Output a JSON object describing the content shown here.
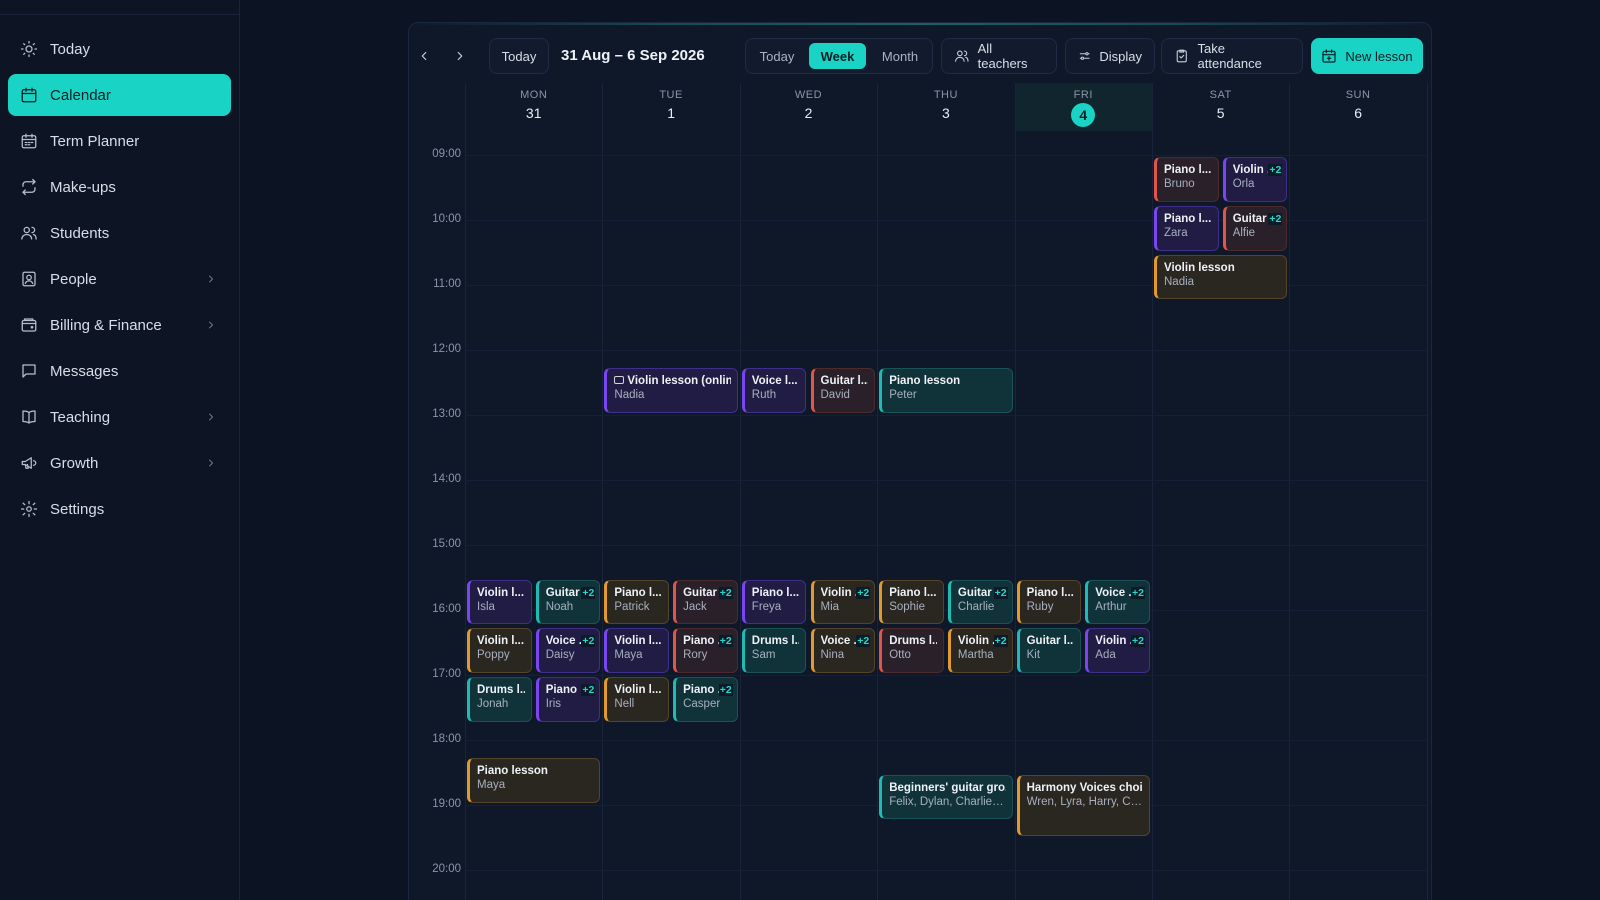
{
  "sidebar": {
    "items": [
      {
        "label": "Today",
        "icon": "sun-icon",
        "active": false
      },
      {
        "label": "Calendar",
        "icon": "calendar-icon",
        "active": true
      },
      {
        "label": "Term Planner",
        "icon": "calendar-grid-icon",
        "active": false
      },
      {
        "label": "Make-ups",
        "icon": "repeat-icon",
        "active": false
      },
      {
        "label": "Students",
        "icon": "users-icon",
        "active": false
      },
      {
        "label": "People",
        "icon": "contact-icon",
        "active": false
      },
      {
        "label": "Billing & Finance",
        "icon": "wallet-icon",
        "active": false
      },
      {
        "label": "Messages",
        "icon": "message-icon",
        "active": false
      },
      {
        "label": "Teaching",
        "icon": "book-icon",
        "active": false
      },
      {
        "label": "Growth",
        "icon": "megaphone-icon",
        "active": false
      },
      {
        "label": "Settings",
        "icon": "gear-icon",
        "active": false
      }
    ]
  },
  "toolbar": {
    "today_button": "Today",
    "range": "31 Aug – 6 Sep 2026",
    "views": [
      "Today",
      "Week",
      "Month"
    ],
    "active_view": "Week",
    "all_teachers": "All teachers",
    "display": "Display",
    "take_attendance": "Take attendance",
    "new_lesson": "New lesson"
  },
  "days": [
    {
      "name": "MON",
      "num": "31"
    },
    {
      "name": "TUE",
      "num": "1"
    },
    {
      "name": "WED",
      "num": "2"
    },
    {
      "name": "THU",
      "num": "3"
    },
    {
      "name": "FRI",
      "num": "4",
      "today": true
    },
    {
      "name": "SAT",
      "num": "5"
    },
    {
      "name": "SUN",
      "num": "6"
    }
  ],
  "times": [
    "09:00",
    "10:00",
    "11:00",
    "12:00",
    "13:00",
    "14:00",
    "15:00",
    "16:00",
    "17:00",
    "18:00",
    "19:00",
    "20:00"
  ],
  "events": [
    {
      "title": "Piano l...",
      "sub": "Bruno",
      "day": 5,
      "sub_col": 0,
      "cols": 2,
      "start": "09:00",
      "end": "09:45",
      "color": "pianored"
    },
    {
      "title": "Violin .",
      "sub": "Orla",
      "badge": "+2",
      "day": 5,
      "sub_col": 1,
      "cols": 2,
      "start": "09:00",
      "end": "09:45",
      "color": "violin"
    },
    {
      "title": "Piano l...",
      "sub": "Zara",
      "day": 5,
      "sub_col": 0,
      "cols": 2,
      "start": "09:45",
      "end": "10:30",
      "color": "purple"
    },
    {
      "title": "Guitar",
      "sub": "Alfie",
      "badge": "+2",
      "day": 5,
      "sub_col": 1,
      "cols": 2,
      "start": "09:45",
      "end": "10:30",
      "color": "red"
    },
    {
      "title": "Violin lesson",
      "sub": "Nadia",
      "day": 5,
      "sub_col": 0,
      "cols": 1,
      "start": "10:30",
      "end": "11:15",
      "color": "orange"
    },
    {
      "title": "Violin lesson (onlin...",
      "sub": "Nadia",
      "camera": true,
      "day": 1,
      "sub_col": 0,
      "cols": 1,
      "start": "12:15",
      "end": "13:00",
      "color": "purple"
    },
    {
      "title": "Voice l...",
      "sub": "Ruth",
      "day": 2,
      "sub_col": 0,
      "cols": 2,
      "start": "12:15",
      "end": "13:00",
      "color": "purple"
    },
    {
      "title": "Guitar l...",
      "sub": "David",
      "day": 2,
      "sub_col": 1,
      "cols": 2,
      "start": "12:15",
      "end": "13:00",
      "color": "red"
    },
    {
      "title": "Piano lesson",
      "sub": "Peter",
      "day": 3,
      "sub_col": 0,
      "cols": 1,
      "start": "12:15",
      "end": "13:00",
      "color": "teal"
    },
    {
      "title": "Violin l...",
      "sub": "Isla",
      "day": 0,
      "sub_col": 0,
      "cols": 2,
      "start": "15:30",
      "end": "16:15",
      "color": "purple"
    },
    {
      "title": "Guitar",
      "sub": "Noah",
      "badge": "+2",
      "day": 0,
      "sub_col": 1,
      "cols": 2,
      "start": "15:30",
      "end": "16:15",
      "color": "teal"
    },
    {
      "title": "Violin l...",
      "sub": "Poppy",
      "day": 0,
      "sub_col": 0,
      "cols": 2,
      "start": "16:15",
      "end": "17:00",
      "color": "orange"
    },
    {
      "title": "Voice .",
      "sub": "Daisy",
      "badge": "+2",
      "day": 0,
      "sub_col": 1,
      "cols": 2,
      "start": "16:15",
      "end": "17:00",
      "color": "purple"
    },
    {
      "title": "Drums l...",
      "sub": "Jonah",
      "day": 0,
      "sub_col": 0,
      "cols": 2,
      "start": "17:00",
      "end": "17:45",
      "color": "teal"
    },
    {
      "title": "Piano .",
      "sub": "Iris",
      "badge": "+2",
      "day": 0,
      "sub_col": 1,
      "cols": 2,
      "start": "17:00",
      "end": "17:45",
      "color": "purple"
    },
    {
      "title": "Piano l...",
      "sub": "Patrick",
      "day": 1,
      "sub_col": 0,
      "cols": 2,
      "start": "15:30",
      "end": "16:15",
      "color": "orange"
    },
    {
      "title": "Guitar",
      "sub": "Jack",
      "badge": "+2",
      "day": 1,
      "sub_col": 1,
      "cols": 2,
      "start": "15:30",
      "end": "16:15",
      "color": "red"
    },
    {
      "title": "Violin l...",
      "sub": "Maya",
      "day": 1,
      "sub_col": 0,
      "cols": 2,
      "start": "16:15",
      "end": "17:00",
      "color": "purple"
    },
    {
      "title": "Piano .",
      "sub": "Rory",
      "badge": "+2",
      "day": 1,
      "sub_col": 1,
      "cols": 2,
      "start": "16:15",
      "end": "17:00",
      "color": "red"
    },
    {
      "title": "Violin l...",
      "sub": "Nell",
      "day": 1,
      "sub_col": 0,
      "cols": 2,
      "start": "17:00",
      "end": "17:45",
      "color": "orange"
    },
    {
      "title": "Piano .",
      "sub": "Casper",
      "badge": "+2",
      "day": 1,
      "sub_col": 1,
      "cols": 2,
      "start": "17:00",
      "end": "17:45",
      "color": "teal"
    },
    {
      "title": "Piano l...",
      "sub": "Freya",
      "day": 2,
      "sub_col": 0,
      "cols": 2,
      "start": "15:30",
      "end": "16:15",
      "color": "purple"
    },
    {
      "title": "Violin .",
      "sub": "Mia",
      "badge": "+2",
      "day": 2,
      "sub_col": 1,
      "cols": 2,
      "start": "15:30",
      "end": "16:15",
      "color": "orange"
    },
    {
      "title": "Drums l...",
      "sub": "Sam",
      "day": 2,
      "sub_col": 0,
      "cols": 2,
      "start": "16:15",
      "end": "17:00",
      "color": "teal"
    },
    {
      "title": "Voice .",
      "sub": "Nina",
      "badge": "+2",
      "day": 2,
      "sub_col": 1,
      "cols": 2,
      "start": "16:15",
      "end": "17:00",
      "color": "orange"
    },
    {
      "title": "Piano l...",
      "sub": "Sophie",
      "day": 3,
      "sub_col": 0,
      "cols": 2,
      "start": "15:30",
      "end": "16:15",
      "color": "orange"
    },
    {
      "title": "Guitar",
      "sub": "Charlie",
      "badge": "+2",
      "day": 3,
      "sub_col": 1,
      "cols": 2,
      "start": "15:30",
      "end": "16:15",
      "color": "teal"
    },
    {
      "title": "Drums l...",
      "sub": "Otto",
      "day": 3,
      "sub_col": 0,
      "cols": 2,
      "start": "16:15",
      "end": "17:00",
      "color": "red"
    },
    {
      "title": "Violin .",
      "sub": "Martha",
      "badge": "+2",
      "day": 3,
      "sub_col": 1,
      "cols": 2,
      "start": "16:15",
      "end": "17:00",
      "color": "orange"
    },
    {
      "title": "Piano l...",
      "sub": "Ruby",
      "day": 4,
      "sub_col": 0,
      "cols": 2,
      "start": "15:30",
      "end": "16:15",
      "color": "orange"
    },
    {
      "title": "Voice .",
      "sub": "Arthur",
      "badge": "+2",
      "day": 4,
      "sub_col": 1,
      "cols": 2,
      "start": "15:30",
      "end": "16:15",
      "color": "teal"
    },
    {
      "title": "Guitar l...",
      "sub": "Kit",
      "day": 4,
      "sub_col": 0,
      "cols": 2,
      "start": "16:15",
      "end": "17:00",
      "color": "teal"
    },
    {
      "title": "Violin .",
      "sub": "Ada",
      "badge": "+2",
      "day": 4,
      "sub_col": 1,
      "cols": 2,
      "start": "16:15",
      "end": "17:00",
      "color": "purple"
    },
    {
      "title": "Piano lesson",
      "sub": "Maya",
      "day": 0,
      "sub_col": 0,
      "cols": 1,
      "start": "18:15",
      "end": "19:00",
      "color": "orange"
    },
    {
      "title": "Beginners' guitar gro...",
      "sub": "Felix, Dylan, Charlie, K...",
      "day": 3,
      "sub_col": 0,
      "cols": 1,
      "start": "18:30",
      "end": "19:15",
      "color": "teal"
    },
    {
      "title": "Harmony Voices choir",
      "sub": "Wren, Lyra, Harry, Cle...",
      "day": 4,
      "sub_col": 0,
      "cols": 1,
      "start": "18:30",
      "end": "19:30",
      "color": "orange"
    }
  ]
}
